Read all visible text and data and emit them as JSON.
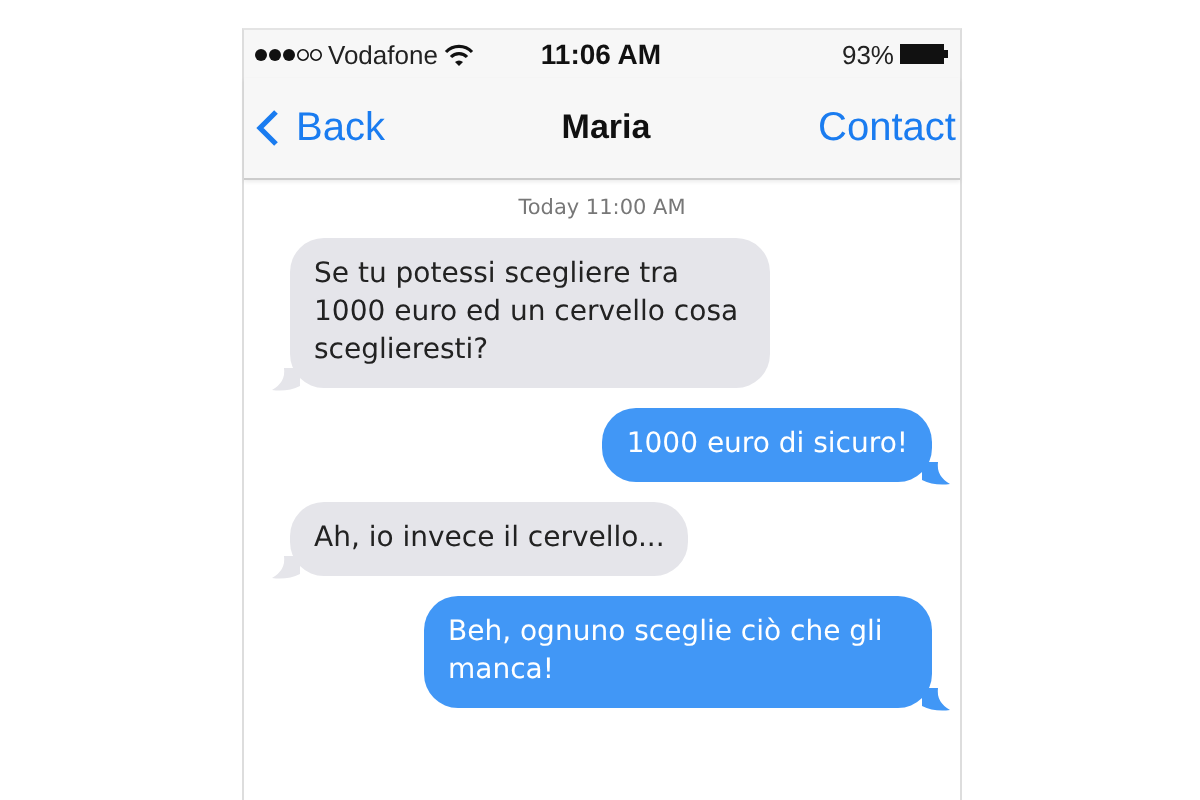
{
  "status_bar": {
    "carrier": "Vodafone",
    "time": "11:06 AM",
    "battery": "93%"
  },
  "nav": {
    "back": "Back",
    "title": "Maria",
    "action": "Contact"
  },
  "timestamp": "Today 11:00 AM",
  "messages": [
    {
      "kind": "received",
      "text": "Se tu potessi scegliere tra 1000 euro ed un cervello cosa sceglieresti?"
    },
    {
      "kind": "sent",
      "text": "1000 euro di sicuro!"
    },
    {
      "kind": "received",
      "text": "Ah, io invece il cervello..."
    },
    {
      "kind": "sent",
      "text": "Beh, ognuno sceglie ciò che gli manca!"
    }
  ]
}
